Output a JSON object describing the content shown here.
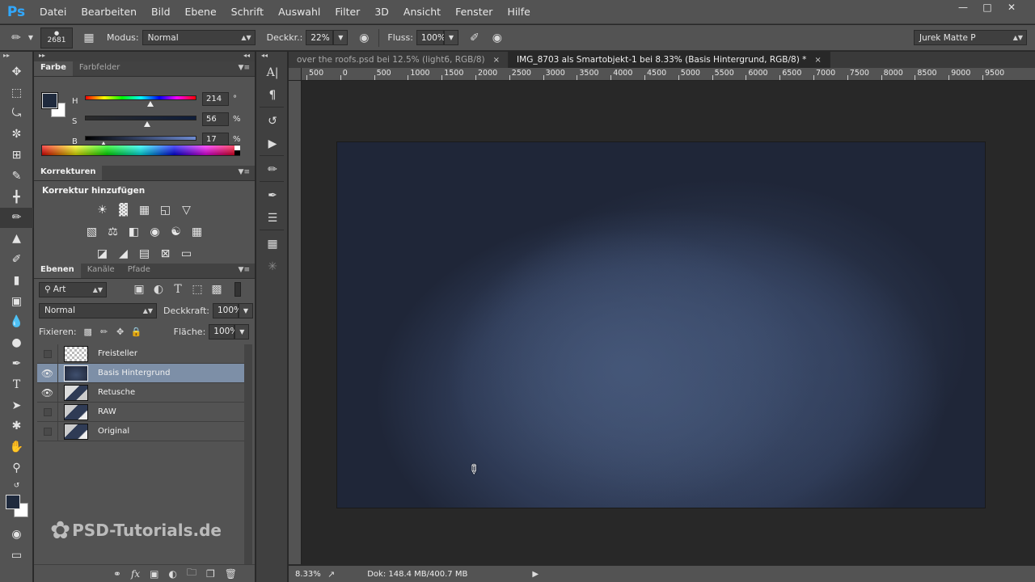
{
  "app": {
    "logo": "Ps",
    "menu": [
      "Datei",
      "Bearbeiten",
      "Bild",
      "Ebene",
      "Schrift",
      "Auswahl",
      "Filter",
      "3D",
      "Ansicht",
      "Fenster",
      "Hilfe"
    ]
  },
  "options": {
    "brush_size": "2681",
    "mode_label": "Modus:",
    "mode_value": "Normal",
    "opacity_label": "Deckkr.:",
    "opacity_value": "22%",
    "flow_label": "Fluss:",
    "flow_value": "100%",
    "workspace": "Jurek Matte P"
  },
  "color_panel": {
    "tabs": [
      "Farbe",
      "Farbfelder"
    ],
    "h": {
      "label": "H",
      "value": "214",
      "unit": "°",
      "fraction": 0.59
    },
    "s": {
      "label": "S",
      "value": "56",
      "unit": "%",
      "fraction": 0.56
    },
    "b": {
      "label": "B",
      "value": "17",
      "unit": "%",
      "fraction": 0.17
    },
    "fg_color": "#1f2a3d",
    "bg_color": "#ffffff"
  },
  "adjustments": {
    "tab": "Korrekturen",
    "title": "Korrektur hinzufügen"
  },
  "layers_panel": {
    "tabs": [
      "Ebenen",
      "Kanäle",
      "Pfade"
    ],
    "filter_kind": "Art",
    "blend_mode": "Normal",
    "opacity_label": "Deckkraft:",
    "opacity_value": "100%",
    "lock_label": "Fixieren:",
    "fill_label": "Fläche:",
    "fill_value": "100%",
    "layers": [
      {
        "name": "Freisteller",
        "visible": false,
        "selected": false
      },
      {
        "name": "Basis Hintergrund",
        "visible": true,
        "selected": true
      },
      {
        "name": "Retusche",
        "visible": true,
        "selected": false
      },
      {
        "name": "RAW",
        "visible": false,
        "selected": false
      },
      {
        "name": "Original",
        "visible": false,
        "selected": false
      }
    ]
  },
  "watermark": "PSD-Tutorials.de",
  "documents": {
    "tabs": [
      {
        "title": "over the roofs.psd bei 12.5% (light6, RGB/8)",
        "active": false
      },
      {
        "title": "IMG_8703 als Smartobjekt-1 bei 8.33% (Basis Hintergrund, RGB/8) *",
        "active": true
      }
    ],
    "ruler_labels": [
      "500",
      "0",
      "500",
      "1000",
      "1500",
      "2000",
      "2500",
      "3000",
      "3500",
      "4000",
      "4500",
      "5000",
      "5500",
      "6000",
      "6500",
      "7000",
      "7500",
      "8000",
      "8500",
      "9000",
      "9500"
    ],
    "close_glyph": "×"
  },
  "status": {
    "zoom": "8.33%",
    "doc": "Dok: 148.4 MB/400.7 MB"
  }
}
